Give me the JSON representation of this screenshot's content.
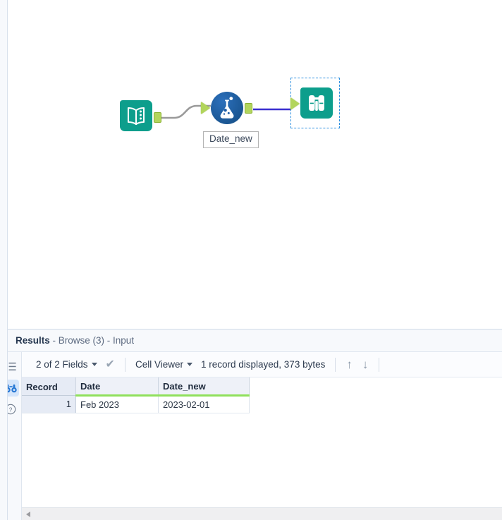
{
  "window": {
    "app": "Alteryx Designer"
  },
  "canvas": {
    "nodes": [
      {
        "id": "input-data",
        "type": "input-data-tool",
        "icon": "open-book-icon",
        "color": "#0d9e8c",
        "label": ""
      },
      {
        "id": "formula",
        "type": "formula-tool",
        "icon": "flask-icon",
        "color": "#1f5fa9",
        "label": "Date_new"
      },
      {
        "id": "browse",
        "type": "browse-tool",
        "icon": "binoculars-icon",
        "color": "#0d9e8c",
        "label": "",
        "selected": true
      }
    ],
    "connections": [
      {
        "from": "input-data",
        "to": "formula",
        "color": "#9a9a9a"
      },
      {
        "from": "formula",
        "to": "browse",
        "color": "#3b2fd0"
      }
    ],
    "annotation": "Date_new"
  },
  "results": {
    "header": {
      "title": "Results",
      "subtitle": " - Browse (3) - Input"
    },
    "rail": [
      {
        "name": "list-view",
        "icon": "list-icon",
        "active": false
      },
      {
        "name": "browse-view",
        "icon": "binoculars-icon",
        "active": true
      },
      {
        "name": "help",
        "icon": "question-circle-icon",
        "active": false
      }
    ],
    "toolbar": {
      "fields_label": "2 of 2 Fields",
      "check_icon": "check-icon",
      "view_mode": "Cell Viewer",
      "status": "1 record displayed, 373 bytes",
      "up_arrow": "↑",
      "down_arrow": "↓"
    },
    "grid": {
      "columns": [
        "Record",
        "Date",
        "Date_new"
      ],
      "rows": [
        {
          "record": "1",
          "date": "Feb 2023",
          "date_new": "2023-02-01"
        }
      ]
    }
  },
  "colors": {
    "teal": "#0d9e8c",
    "blue_tool": "#1f5fa9",
    "wire_blue": "#3b2fd0",
    "wire_grey": "#9a9a9a",
    "anchor_green": "#b2d55c",
    "header_underline": "#8fe05c",
    "selection": "#2b8fe0"
  }
}
